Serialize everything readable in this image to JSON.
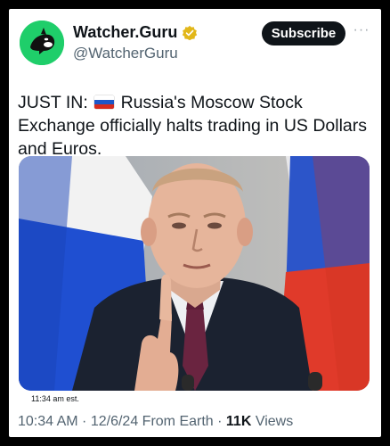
{
  "account": {
    "display_name": "Watcher.Guru",
    "handle": "@WatcherGuru",
    "avatar_color": "#1fce6a",
    "verified_color": "#e2b719"
  },
  "actions": {
    "subscribe_label": "Subscribe",
    "more_label": "···"
  },
  "tweet": {
    "prefix": "JUST IN:",
    "flag_icon": "russia-flag-icon",
    "text": "Russia's Moscow Stock Exchange officially halts trading in US Dollars and Euros."
  },
  "media": {
    "description_icon": "photo-image",
    "flag_colors": [
      "#ffffff",
      "#1f4fd1",
      "#e03a2a"
    ]
  },
  "overlay_time": "11:34 am est.",
  "meta": {
    "time": "10:34 AM",
    "sep1": " · ",
    "date": "12/6/24",
    "source": " From Earth",
    "sep2": " · ",
    "views_count": "11K",
    "views_label": " Views"
  }
}
